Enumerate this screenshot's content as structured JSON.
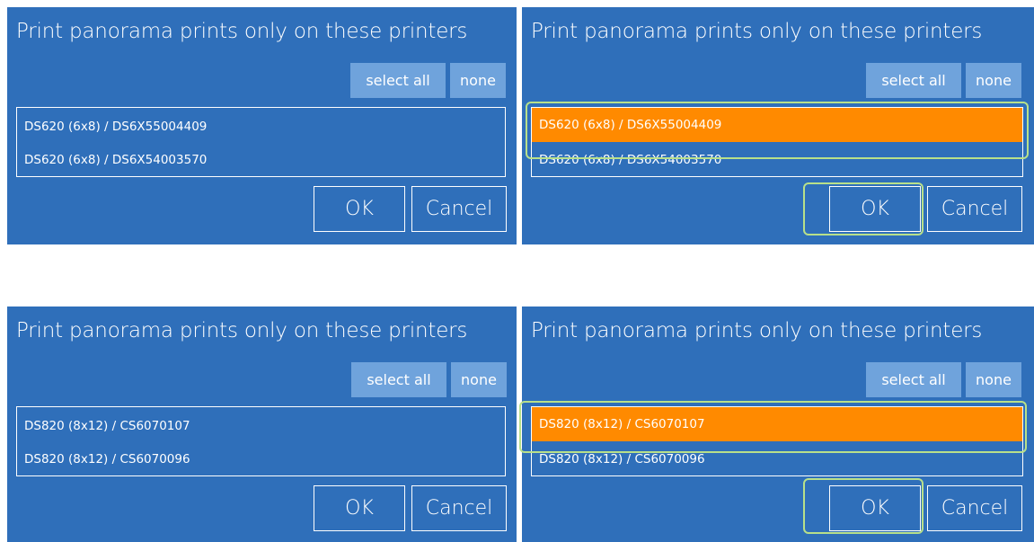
{
  "colors": {
    "panel_bg": "#2f6fba",
    "chip_bg": "#6fa3dc",
    "selected_bg": "#ff8a00",
    "highlight_outline": "#b8e08a"
  },
  "panels": [
    {
      "title": "Print panorama prints only on these printers",
      "select_all_label": "select all",
      "none_label": "none",
      "printers": [
        {
          "label": "DS620 (6x8) / DS6X55004409",
          "selected": false
        },
        {
          "label": "DS620 (6x8) / DS6X54003570",
          "selected": false
        }
      ],
      "ok_label": "OK",
      "cancel_label": "Cancel"
    },
    {
      "title": "Print panorama prints only on these printers",
      "select_all_label": "select all",
      "none_label": "none",
      "printers": [
        {
          "label": "DS620 (6x8) / DS6X55004409",
          "selected": true
        },
        {
          "label": "DS620 (6x8) / DS6X54003570",
          "selected": false
        }
      ],
      "ok_label": "OK",
      "cancel_label": "Cancel"
    },
    {
      "title": "Print panorama prints only on these printers",
      "select_all_label": "select all",
      "none_label": "none",
      "printers": [
        {
          "label": "DS820 (8x12) / CS6070107",
          "selected": false
        },
        {
          "label": "DS820 (8x12) / CS6070096",
          "selected": false
        }
      ],
      "ok_label": "OK",
      "cancel_label": "Cancel"
    },
    {
      "title": "Print panorama prints only on these printers",
      "select_all_label": "select all",
      "none_label": "none",
      "printers": [
        {
          "label": "DS820 (8x12) / CS6070107",
          "selected": true
        },
        {
          "label": "DS820 (8x12) / CS6070096",
          "selected": false
        }
      ],
      "ok_label": "OK",
      "cancel_label": "Cancel"
    }
  ]
}
